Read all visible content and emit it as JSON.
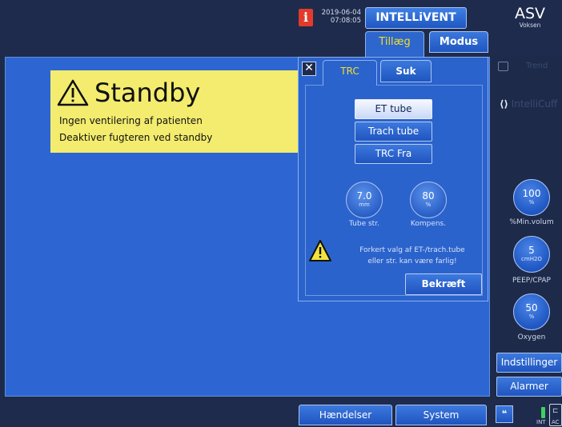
{
  "header": {
    "date": "2019-06-04",
    "time": "07:08:05",
    "mode_title": "INTELLiVENT",
    "ventilation_mode": "ASV",
    "patient_group": "Voksen",
    "tabs": [
      {
        "label": "Tillæg",
        "active": true
      },
      {
        "label": "Modus",
        "active": false
      }
    ]
  },
  "standby": {
    "title": "Standby",
    "line1": "Ingen ventilering af patienten",
    "line2": "Deaktiver fugteren ved standby",
    "background_color": "#f3ec6e"
  },
  "trc_panel": {
    "close_label": "✕",
    "tabs": [
      {
        "label": "TRC",
        "active": true
      },
      {
        "label": "Suk",
        "active": false
      }
    ],
    "options": [
      {
        "label": "ET tube",
        "selected": true
      },
      {
        "label": "Trach tube",
        "selected": false
      },
      {
        "label": "TRC Fra",
        "selected": false
      }
    ],
    "tube_size": {
      "value": "7.0",
      "unit": "mm",
      "label": "Tube str."
    },
    "compensation": {
      "value": "80",
      "unit": "%",
      "label": "Kompens."
    },
    "warning_line1": "Forkert valg af ET-/trach.tube",
    "warning_line2": "eller str. kan være farlig!",
    "confirm_label": "Bekræft"
  },
  "sidebar": {
    "trend_label": "Trend",
    "intellicuff_label": "IntelliCuff",
    "minute_volume": {
      "value": "100",
      "unit": "%",
      "label": "%Min.volum"
    },
    "peep": {
      "value": "5",
      "unit": "cmH2O",
      "label": "PEEP/CPAP"
    },
    "oxygen": {
      "value": "50",
      "unit": "%",
      "label": "Oxygen"
    },
    "settings_label": "Indstillinger",
    "alarms_label": "Alarmer"
  },
  "footer": {
    "events_label": "Hændelser",
    "system_label": "System",
    "int_label": "INT",
    "ac_label": "AC"
  },
  "colors": {
    "accent_yellow": "#f4df2a",
    "panel_blue": "#2d66d2",
    "info_red": "#e23a2b",
    "battery_green": "#3fd25d"
  }
}
